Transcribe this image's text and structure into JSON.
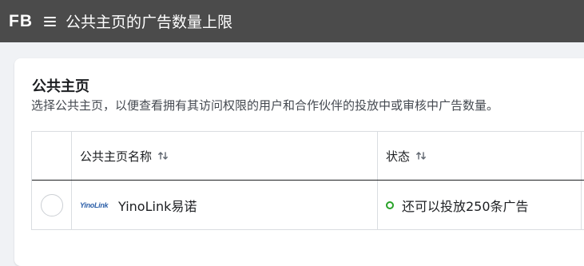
{
  "topbar": {
    "logo": "FB",
    "title": "公共主页的广告数量上限",
    "menu_icon": "hamburger-menu-icon"
  },
  "card": {
    "heading": "公共主页",
    "description": "选择公共主页，以便查看拥有其访问权限的用户和合作伙伴的投放中或审核中广告数量。"
  },
  "table": {
    "columns": [
      {
        "label": "公共主页名称",
        "sort_icon": "sort-arrows-icon"
      },
      {
        "label": "状态",
        "sort_icon": "sort-arrows-icon"
      }
    ],
    "rows": [
      {
        "selected": false,
        "logo_text": "YinoLink",
        "page_name": "YinoLink易诺",
        "status": "还可以投放250条广告",
        "status_color": "#2aa32a"
      }
    ]
  },
  "colors": {
    "topbar_bg": "#4b4b4b",
    "page_bg": "#f0f2f5",
    "status_ok": "#2aa32a"
  }
}
